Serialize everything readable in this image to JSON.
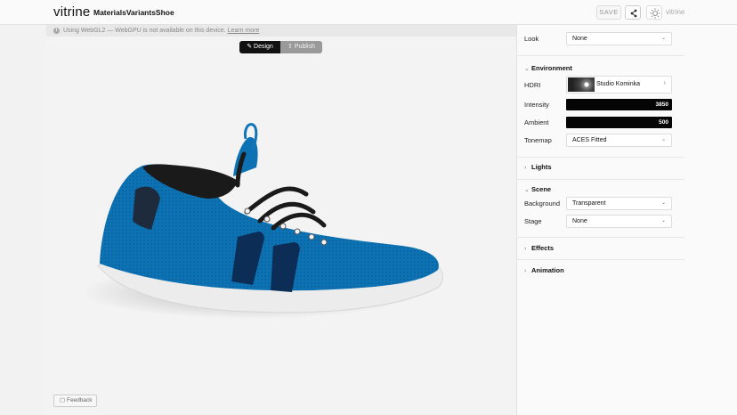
{
  "app": {
    "brand": "vitrine",
    "model_name": "MaterialsVariantsShoe",
    "save_label": "SAVE",
    "tag": "vitrine"
  },
  "viewport": {
    "notice": "Using WebGL2 — WebGPU is not available on this device.",
    "learn_more": "Learn more",
    "design_label": "Design",
    "publish_label": "Publish",
    "feedback_label": "Feedback"
  },
  "panel": {
    "look": {
      "label": "Look",
      "value": "None"
    },
    "environment": {
      "title": "Environment",
      "hdri_label": "HDRI",
      "hdri_value": "Studio Kominka",
      "intensity_label": "Intensity",
      "intensity_value": "3850",
      "ambient_label": "Ambient",
      "ambient_value": "500",
      "tonemap_label": "Tonemap",
      "tonemap_value": "ACES Fitted"
    },
    "lights_title": "Lights",
    "scene": {
      "title": "Scene",
      "background_label": "Background",
      "background_value": "Transparent",
      "stage_label": "Stage",
      "stage_value": "None"
    },
    "effects_title": "Effects",
    "animation_title": "Animation"
  },
  "colors": {
    "shoe_blue": "#0b6fb0",
    "shoe_stripe": "#0c2d55",
    "sole": "#e9e9e9",
    "accent": "#111111"
  }
}
